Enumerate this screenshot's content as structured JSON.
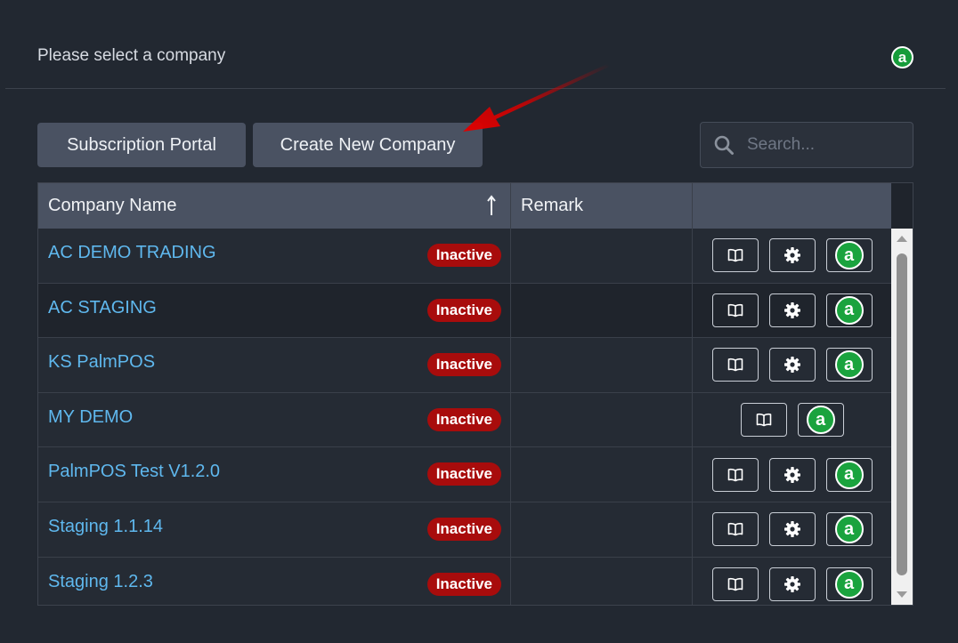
{
  "header": {
    "title": "Please select a company",
    "logo_letter": "a"
  },
  "toolbar": {
    "subscription_label": "Subscription Portal",
    "create_label": "Create New Company",
    "search_placeholder": "Search..."
  },
  "table": {
    "columns": [
      "Company Name",
      "Remark",
      ""
    ],
    "rows": [
      {
        "name": "AC DEMO TRADING",
        "status": "Inactive",
        "remark": "",
        "has_settings": true
      },
      {
        "name": "AC STAGING",
        "status": "Inactive",
        "remark": "",
        "has_settings": true
      },
      {
        "name": "KS PalmPOS",
        "status": "Inactive",
        "remark": "",
        "has_settings": true
      },
      {
        "name": "MY DEMO",
        "status": "Inactive",
        "remark": "",
        "has_settings": false
      },
      {
        "name": "PalmPOS Test V1.2.0",
        "status": "Inactive",
        "remark": "",
        "has_settings": true
      },
      {
        "name": "Staging 1.1.14",
        "status": "Inactive",
        "remark": "",
        "has_settings": true
      },
      {
        "name": "Staging 1.2.3",
        "status": "Inactive",
        "remark": "",
        "has_settings": true
      }
    ],
    "row_logo_letter": "a"
  },
  "icons": {
    "book": "book-icon",
    "settings": "gear-icon",
    "search": "search-icon",
    "sort": "sort-ascending-icon",
    "logo": "app-logo-icon"
  },
  "colors": {
    "background": "#222831",
    "link": "#5fb8ee",
    "badge_inactive": "#a80c0c",
    "logo_green": "#1aa33e",
    "annotation_arrow": "#d40000"
  }
}
